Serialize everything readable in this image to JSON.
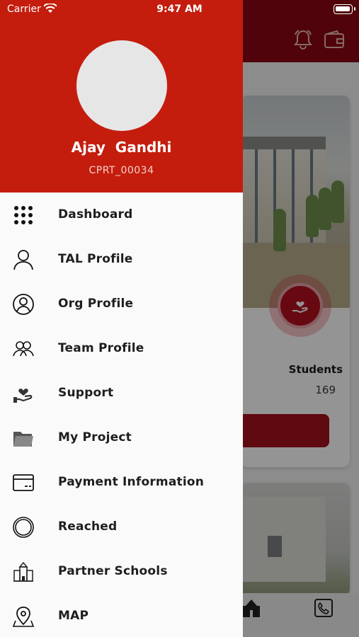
{
  "status_bar": {
    "carrier": "Carrier",
    "time": "9:47 AM"
  },
  "profile": {
    "name": "Ajay  Gandhi",
    "id": "CPRT_00034"
  },
  "menu": [
    {
      "label": "Dashboard",
      "icon": "grid-icon"
    },
    {
      "label": "TAL Profile",
      "icon": "user-icon"
    },
    {
      "label": "Org Profile",
      "icon": "user-circle-icon"
    },
    {
      "label": "Team Profile",
      "icon": "team-icon"
    },
    {
      "label": "Support",
      "icon": "hand-heart-icon"
    },
    {
      "label": "My Project",
      "icon": "folder-icon"
    },
    {
      "label": "Payment Information",
      "icon": "card-icon"
    },
    {
      "label": "Reached",
      "icon": "circle-icon"
    },
    {
      "label": "Partner Schools",
      "icon": "school-icon"
    },
    {
      "label": "MAP",
      "icon": "map-pin-icon"
    }
  ],
  "background": {
    "students_label": "Students",
    "students_value": "169"
  },
  "colors": {
    "header": "#c51d0d",
    "app_bar": "#8b0612",
    "accent": "#b3101e"
  }
}
